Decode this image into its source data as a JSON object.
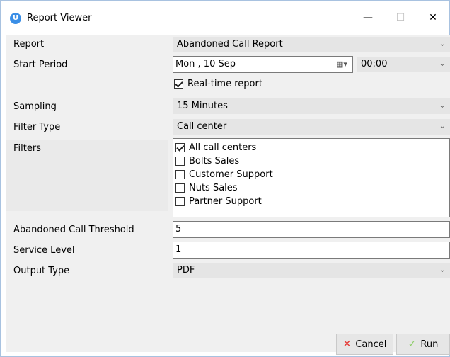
{
  "window": {
    "title": "Report Viewer",
    "app_icon_letter": "U",
    "min_glyph": "—",
    "max_glyph": "☐",
    "close_glyph": "✕"
  },
  "form": {
    "report": {
      "label": "Report",
      "value": "Abandoned Call Report"
    },
    "start_period": {
      "label": "Start Period",
      "date": "Mon , 10 Sep",
      "time": "00:00"
    },
    "realtime": {
      "label": "Real-time report",
      "checked": true
    },
    "sampling": {
      "label": "Sampling",
      "value": "15 Minutes"
    },
    "filter_type": {
      "label": "Filter Type",
      "value": "Call center"
    },
    "filters": {
      "label": "Filters",
      "items": [
        {
          "label": "All call centers",
          "checked": true
        },
        {
          "label": "Bolts Sales",
          "checked": false
        },
        {
          "label": "Customer Support",
          "checked": false
        },
        {
          "label": "Nuts Sales",
          "checked": false
        },
        {
          "label": "Partner Support",
          "checked": false
        }
      ]
    },
    "abandoned_threshold": {
      "label": "Abandoned Call Threshold",
      "value": "5"
    },
    "service_level": {
      "label": "Service Level",
      "value": "1"
    },
    "output_type": {
      "label": "Output Type",
      "value": "PDF"
    }
  },
  "buttons": {
    "cancel_label": "Cancel",
    "cancel_icon": "✕",
    "run_label": "Run",
    "run_icon": "✓"
  },
  "colors": {
    "accent": "#3a8ee6",
    "cancel_icon": "#e53935",
    "run_icon": "#8fce6a"
  }
}
